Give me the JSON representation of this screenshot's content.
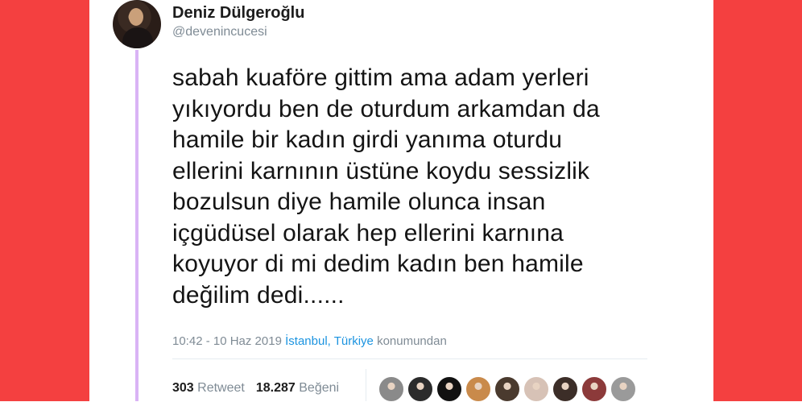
{
  "tweet": {
    "author_name": "Deniz Dülgeroğlu",
    "handle": "@devenincucesi",
    "text_lines": [
      "sabah kuaföre gittim ama adam yerleri",
      "yıkıyordu ben de oturdum arkamdan da",
      "hamile bir kadın girdi yanıma oturdu",
      "ellerini karnının üstüne koydu sessizlik",
      "bozulsun diye hamile olunca insan",
      "içgüdüsel olarak hep ellerini karnına",
      "koyuyor di mi dedim kadın ben hamile",
      "değilim dedi......"
    ],
    "timestamp": "10:42 - 10 Haz 2019",
    "location": "İstanbul, Türkiye",
    "location_suffix": "konumundan",
    "retweet_count": "303",
    "retweet_label": "Retweet",
    "like_count": "18.287",
    "like_label": "Beğeni"
  },
  "colors": {
    "side_panels": "#f44040",
    "thread_line": "#d9b3f5",
    "link": "#1c94e0",
    "muted": "#7f8b95"
  },
  "liker_avatars": [
    {
      "icon": "liker-avatar",
      "color": "#8a8a8a"
    },
    {
      "icon": "liker-avatar",
      "color": "#2b2b2b"
    },
    {
      "icon": "liker-avatar",
      "color": "#111111"
    },
    {
      "icon": "liker-avatar",
      "color": "#c98a4b"
    },
    {
      "icon": "liker-avatar",
      "color": "#4a3a2e"
    },
    {
      "icon": "liker-avatar",
      "color": "#d7c2b6"
    },
    {
      "icon": "liker-avatar",
      "color": "#3c2e28"
    },
    {
      "icon": "liker-avatar",
      "color": "#8c3a3a"
    },
    {
      "icon": "liker-avatar",
      "color": "#9a9a9a"
    }
  ]
}
